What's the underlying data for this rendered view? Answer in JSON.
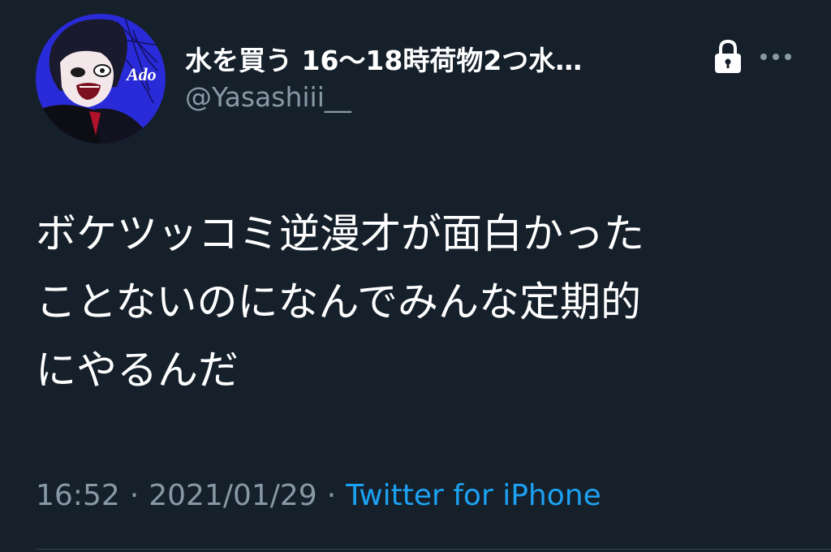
{
  "tweet": {
    "display_name": "水を買う 16〜18時荷物2つ水…",
    "handle": "@Yasashiii__",
    "avatar_text": "Ado",
    "text_lines": [
      "ボケツッコミ逆漫才が面白かった",
      "ことないのになんでみんな定期的",
      "にやるんだ"
    ],
    "time": "16:52",
    "date": "2021/01/29",
    "separator": "·",
    "source": "Twitter for iPhone",
    "icons": {
      "lock": "lock-icon",
      "more": "more-icon"
    }
  },
  "colors": {
    "background": "#15202b",
    "text": "#ffffff",
    "secondary": "#8899a6",
    "link": "#1da1f2",
    "avatar_bg": "#2a2bd8"
  }
}
